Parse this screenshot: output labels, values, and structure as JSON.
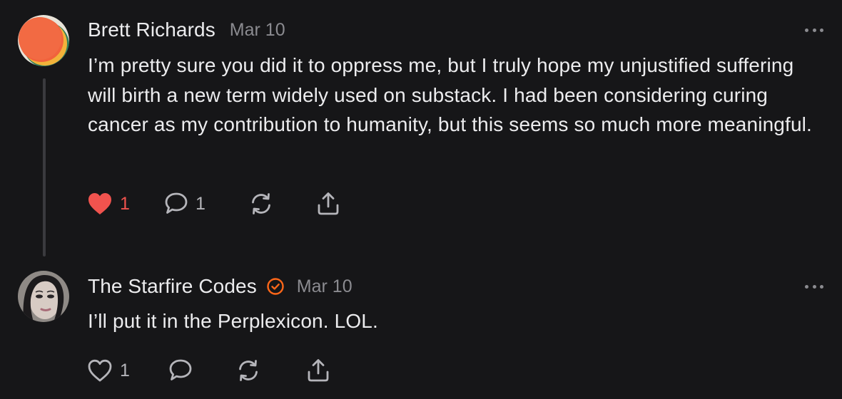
{
  "comments": [
    {
      "author": "Brett Richards",
      "date": "Mar 10",
      "verified": false,
      "body": "I’m pretty sure you did it to oppress me, but I truly hope my unjustified suffering will birth a new term widely used on substack. I had been considering curing cancer as my contribution to humanity, but this seems so much more meaningful.",
      "likes": "1",
      "liked": true,
      "replies": "1",
      "icons": [
        "heart-filled-icon",
        "comment-icon",
        "restack-icon",
        "share-icon"
      ]
    },
    {
      "author": "The Starfire Codes",
      "date": "Mar 10",
      "verified": true,
      "body": "I’ll put it in the Perplexicon. LOL.",
      "likes": "1",
      "liked": false,
      "replies": "",
      "icons": [
        "heart-outline-icon",
        "comment-icon",
        "restack-icon",
        "share-icon"
      ]
    }
  ],
  "colors": {
    "background": "#161618",
    "text": "#ececee",
    "muted": "#8b8b90",
    "like_active": "#f0534e",
    "verified_badge": "#ff6719"
  }
}
